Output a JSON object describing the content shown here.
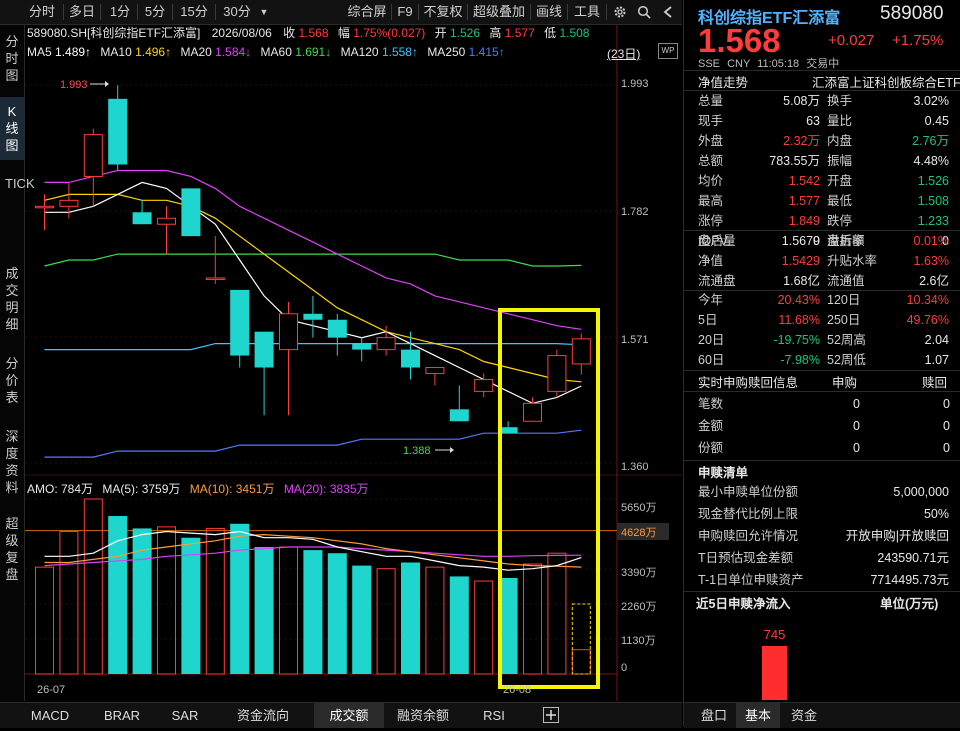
{
  "toolbar": {
    "periods": [
      "分时",
      "多日",
      "1分",
      "5分",
      "15分",
      "30分"
    ],
    "actions": [
      "综合屏",
      "F9",
      "不复权",
      "超级叠加",
      "画线",
      "工具"
    ],
    "wp_label": "WP"
  },
  "sidenav": {
    "items": [
      "分时图",
      "K线图",
      "TICK",
      "成交明细",
      "分价表",
      "深度资料",
      "超级复盘"
    ]
  },
  "chart": {
    "code_name": "589080.SH[科创综指ETF汇添富]",
    "date": "2026/08/06",
    "close_label": "收",
    "close_value": "1.568",
    "change_label": "幅",
    "change_value": "1.75%(0.027)",
    "open_label": "开",
    "open_value": "1.526",
    "high_label": "高",
    "high_value": "1.577",
    "low_label": "低",
    "low_value": "1.508",
    "ma": [
      {
        "name": "MA5",
        "value": "1.489↑",
        "color": "#ffffff"
      },
      {
        "name": "MA10",
        "value": "1.496↑",
        "color": "#ffd400"
      },
      {
        "name": "MA20",
        "value": "1.584↓",
        "color": "#e040fb"
      },
      {
        "name": "MA60",
        "value": "1.691↓",
        "color": "#3ddc4a"
      },
      {
        "name": "MA120",
        "value": "1.558↑",
        "color": "#40c4ff"
      },
      {
        "name": "MA250",
        "value": "1.415↑",
        "color": "#4f7cff"
      }
    ],
    "period_badge": "(23日)",
    "price_axis": [
      "1.993",
      "1.782",
      "1.571",
      "1.360"
    ],
    "high_mark": "1.993",
    "low_mark": "1.388",
    "volume_header": {
      "amo": "AMO: 784万",
      "ma5": "MA(5): 3759万",
      "ma10": "MA(10): 3451万",
      "ma20": "MA(20): 3835万"
    },
    "volume_axis": [
      "5650万",
      "4628万",
      "3390万",
      "2260万",
      "1130万",
      "0"
    ],
    "vol_current_tag": "4628万",
    "date_labels": [
      "26-07",
      "26-08"
    ]
  },
  "chart_data": {
    "type": "candlestick",
    "candles": [
      {
        "o": 1.79,
        "h": 1.81,
        "l": 1.75,
        "c": 1.79
      },
      {
        "o": 1.79,
        "h": 1.83,
        "l": 1.77,
        "c": 1.8
      },
      {
        "o": 1.84,
        "h": 1.92,
        "l": 1.79,
        "c": 1.91
      },
      {
        "o": 1.97,
        "h": 1.993,
        "l": 1.85,
        "c": 1.86
      },
      {
        "o": 1.78,
        "h": 1.8,
        "l": 1.76,
        "c": 1.76
      },
      {
        "o": 1.76,
        "h": 1.79,
        "l": 1.71,
        "c": 1.77
      },
      {
        "o": 1.82,
        "h": 1.82,
        "l": 1.74,
        "c": 1.74
      },
      {
        "o": 1.67,
        "h": 1.74,
        "l": 1.66,
        "c": 1.67
      },
      {
        "o": 1.65,
        "h": 1.65,
        "l": 1.52,
        "c": 1.54
      },
      {
        "o": 1.58,
        "h": 1.58,
        "l": 1.44,
        "c": 1.52
      },
      {
        "o": 1.55,
        "h": 1.63,
        "l": 1.44,
        "c": 1.61
      },
      {
        "o": 1.61,
        "h": 1.64,
        "l": 1.57,
        "c": 1.6
      },
      {
        "o": 1.6,
        "h": 1.61,
        "l": 1.54,
        "c": 1.57
      },
      {
        "o": 1.56,
        "h": 1.57,
        "l": 1.53,
        "c": 1.55
      },
      {
        "o": 1.55,
        "h": 1.59,
        "l": 1.54,
        "c": 1.57
      },
      {
        "o": 1.55,
        "h": 1.58,
        "l": 1.5,
        "c": 1.52
      },
      {
        "o": 1.51,
        "h": 1.52,
        "l": 1.49,
        "c": 1.52
      },
      {
        "o": 1.45,
        "h": 1.49,
        "l": 1.43,
        "c": 1.43
      },
      {
        "o": 1.48,
        "h": 1.51,
        "l": 1.47,
        "c": 1.5
      },
      {
        "o": 1.42,
        "h": 1.43,
        "l": 1.41,
        "c": 1.41
      },
      {
        "o": 1.43,
        "h": 1.47,
        "l": 1.43,
        "c": 1.46
      },
      {
        "o": 1.48,
        "h": 1.55,
        "l": 1.47,
        "c": 1.54
      },
      {
        "o": 1.526,
        "h": 1.577,
        "l": 1.508,
        "c": 1.568
      }
    ],
    "ma5": [
      1.78,
      1.78,
      1.79,
      1.81,
      1.83,
      1.82,
      1.79,
      1.76,
      1.7,
      1.64,
      1.6,
      1.59,
      1.58,
      1.57,
      1.58,
      1.56,
      1.54,
      1.52,
      1.5,
      1.48,
      1.46,
      1.47,
      1.489
    ],
    "ma10": [
      1.8,
      1.81,
      1.81,
      1.81,
      1.8,
      1.8,
      1.79,
      1.77,
      1.74,
      1.71,
      1.68,
      1.65,
      1.62,
      1.6,
      1.58,
      1.57,
      1.56,
      1.55,
      1.53,
      1.52,
      1.51,
      1.5,
      1.496
    ],
    "ma20": [
      1.83,
      1.83,
      1.84,
      1.85,
      1.85,
      1.85,
      1.84,
      1.82,
      1.79,
      1.77,
      1.75,
      1.73,
      1.71,
      1.69,
      1.67,
      1.66,
      1.64,
      1.63,
      1.62,
      1.61,
      1.6,
      1.59,
      1.584
    ],
    "ma60": [
      1.69,
      1.7,
      1.7,
      1.71,
      1.71,
      1.71,
      1.71,
      1.71,
      1.71,
      1.71,
      1.71,
      1.71,
      1.71,
      1.71,
      1.71,
      1.71,
      1.71,
      1.7,
      1.7,
      1.7,
      1.69,
      1.69,
      1.691
    ],
    "ma120": [
      1.55,
      1.55,
      1.55,
      1.55,
      1.55,
      1.55,
      1.55,
      1.56,
      1.56,
      1.56,
      1.56,
      1.56,
      1.56,
      1.56,
      1.56,
      1.56,
      1.56,
      1.56,
      1.56,
      1.56,
      1.56,
      1.56,
      1.558
    ],
    "ma250": [
      1.37,
      1.37,
      1.37,
      1.38,
      1.38,
      1.38,
      1.38,
      1.38,
      1.39,
      1.39,
      1.39,
      1.39,
      1.39,
      1.4,
      1.4,
      1.4,
      1.4,
      1.4,
      1.41,
      1.41,
      1.41,
      1.41,
      1.415
    ],
    "volume": [
      3450,
      4600,
      5650,
      5100,
      4700,
      4750,
      4400,
      4700,
      4850,
      4100,
      4100,
      4000,
      3900,
      3500,
      3400,
      3600,
      3450,
      3150,
      3000,
      3100,
      3550,
      3900,
      784
    ],
    "vol_ma5": [
      3800,
      3800,
      3900,
      4300,
      4500,
      4600,
      4550,
      4500,
      4600,
      4400,
      4400,
      4350,
      4100,
      3950,
      3800,
      3800,
      3650,
      3500,
      3450,
      3350,
      3400,
      3500,
      3759
    ],
    "vol_ma10": [
      3600,
      3600,
      3700,
      3800,
      4000,
      4100,
      4200,
      4300,
      4450,
      4500,
      4450,
      4400,
      4300,
      4200,
      4050,
      3950,
      3850,
      3750,
      3650,
      3550,
      3500,
      3480,
      3451
    ],
    "vol_ma20": [
      3500,
      3550,
      3600,
      3650,
      3700,
      3800,
      3850,
      3900,
      4000,
      4050,
      4100,
      4100,
      4100,
      4050,
      4000,
      3950,
      3900,
      3850,
      3800,
      3800,
      3820,
      3830,
      3835
    ],
    "ylim": [
      1.345,
      2.03
    ],
    "vol_ylim": [
      0,
      5650
    ],
    "highlight_from_index": 20
  },
  "quote": {
    "name": "科创综指ETF汇添富",
    "code": "589080",
    "price": "1.568",
    "change": "+0.027",
    "change_pct": "+1.75%",
    "market": "SSE",
    "currency": "CNY",
    "time": "11:05:18",
    "status": "交易中",
    "section_title": "净值走势",
    "full_name": "汇添富上证科创板综合ETF"
  },
  "stats": [
    {
      "l1": "总量",
      "v1": "5.08万",
      "c1": "#e8e8e8",
      "l2": "换手",
      "v2": "3.02%",
      "c2": "#e8e8e8"
    },
    {
      "l1": "现手",
      "v1": "63",
      "c1": "#e8e8e8",
      "l2": "量比",
      "v2": "0.45",
      "c2": "#e8e8e8"
    },
    {
      "l1": "外盘",
      "v1": "2.32万",
      "c1": "#ff3b3b",
      "l2": "内盘",
      "v2": "2.76万",
      "c2": "#1ec27a"
    },
    {
      "l1": "总额",
      "v1": "783.55万",
      "c1": "#e8e8e8",
      "l2": "振幅",
      "v2": "4.48%",
      "c2": "#e8e8e8"
    },
    {
      "l1": "均价",
      "v1": "1.542",
      "c1": "#ff3b3b",
      "l2": "开盘",
      "v2": "1.526",
      "c2": "#1ec27a"
    },
    {
      "l1": "最高",
      "v1": "1.577",
      "c1": "#ff3b3b",
      "l2": "最低",
      "v2": "1.508",
      "c2": "#1ec27a"
    },
    {
      "l1": "涨停",
      "v1": "1.849",
      "c1": "#ff3b3b",
      "l2": "跌停",
      "v2": "1.233",
      "c2": "#1ec27a"
    },
    {
      "l1": "盘后量",
      "v1": "0",
      "c1": "#e8e8e8",
      "l2": "盘后额",
      "v2": "0",
      "c2": "#e8e8e8"
    }
  ],
  "iopv": [
    {
      "l1": "IOPV",
      "v1": "1.5679",
      "c1": "#e8e8e8",
      "l2": "溢折率",
      "v2": "0.01%",
      "c2": "#ff3b3b"
    },
    {
      "l1": "净值",
      "v1": "1.5429",
      "c1": "#ff3b3b",
      "l2": "升贴水率",
      "v2": "1.63%",
      "c2": "#ff3b3b"
    },
    {
      "l1": "流通盘",
      "v1": "1.68亿",
      "c1": "#e8e8e8",
      "l2": "流通值",
      "v2": "2.6亿",
      "c2": "#e8e8e8"
    }
  ],
  "returns": [
    {
      "l1": "今年",
      "v1": "20.43%",
      "c1": "#ff3b3b",
      "l2": "120日",
      "v2": "10.34%",
      "c2": "#ff3b3b"
    },
    {
      "l1": "5日",
      "v1": "11.68%",
      "c1": "#ff3b3b",
      "l2": "250日",
      "v2": "49.76%",
      "c2": "#ff3b3b"
    },
    {
      "l1": "20日",
      "v1": "-19.75%",
      "c1": "#1ec27a",
      "l2": "52周高",
      "v2": "2.04",
      "c2": "#e8e8e8"
    },
    {
      "l1": "60日",
      "v1": "-7.98%",
      "c1": "#1ec27a",
      "l2": "52周低",
      "v2": "1.07",
      "c2": "#e8e8e8"
    }
  ],
  "redemption": {
    "title": "实时申购赎回信息",
    "col_buy": "申购",
    "col_sell": "赎回",
    "rows": [
      {
        "label": "笔数",
        "buy": "0",
        "sell": "0"
      },
      {
        "label": "金额",
        "buy": "0",
        "sell": "0"
      },
      {
        "label": "份额",
        "buy": "0",
        "sell": "0"
      }
    ]
  },
  "list": {
    "title": "申赎清单",
    "rows": [
      {
        "label": "最小申赎单位份额",
        "value": "5,000,000"
      },
      {
        "label": "现金替代比例上限",
        "value": "50%"
      },
      {
        "label": "申购赎回允许情况",
        "value": "开放申购|开放赎回"
      },
      {
        "label": "T日预估现金差额",
        "value": "243590.71元"
      },
      {
        "label": "T-1日单位申赎资产",
        "value": "7714495.73元"
      }
    ]
  },
  "netflow": {
    "title": "近5日申赎净流入",
    "unit": "单位(万元)",
    "bar_value": "745"
  },
  "bottom_tabs": [
    "MACD",
    "BRAR",
    "SAR",
    "资金流向",
    "成交额",
    "融资余额",
    "RSI"
  ],
  "bottom_active": 4,
  "right_tabs": [
    "盘口",
    "基本",
    "资金"
  ],
  "right_active": 1
}
